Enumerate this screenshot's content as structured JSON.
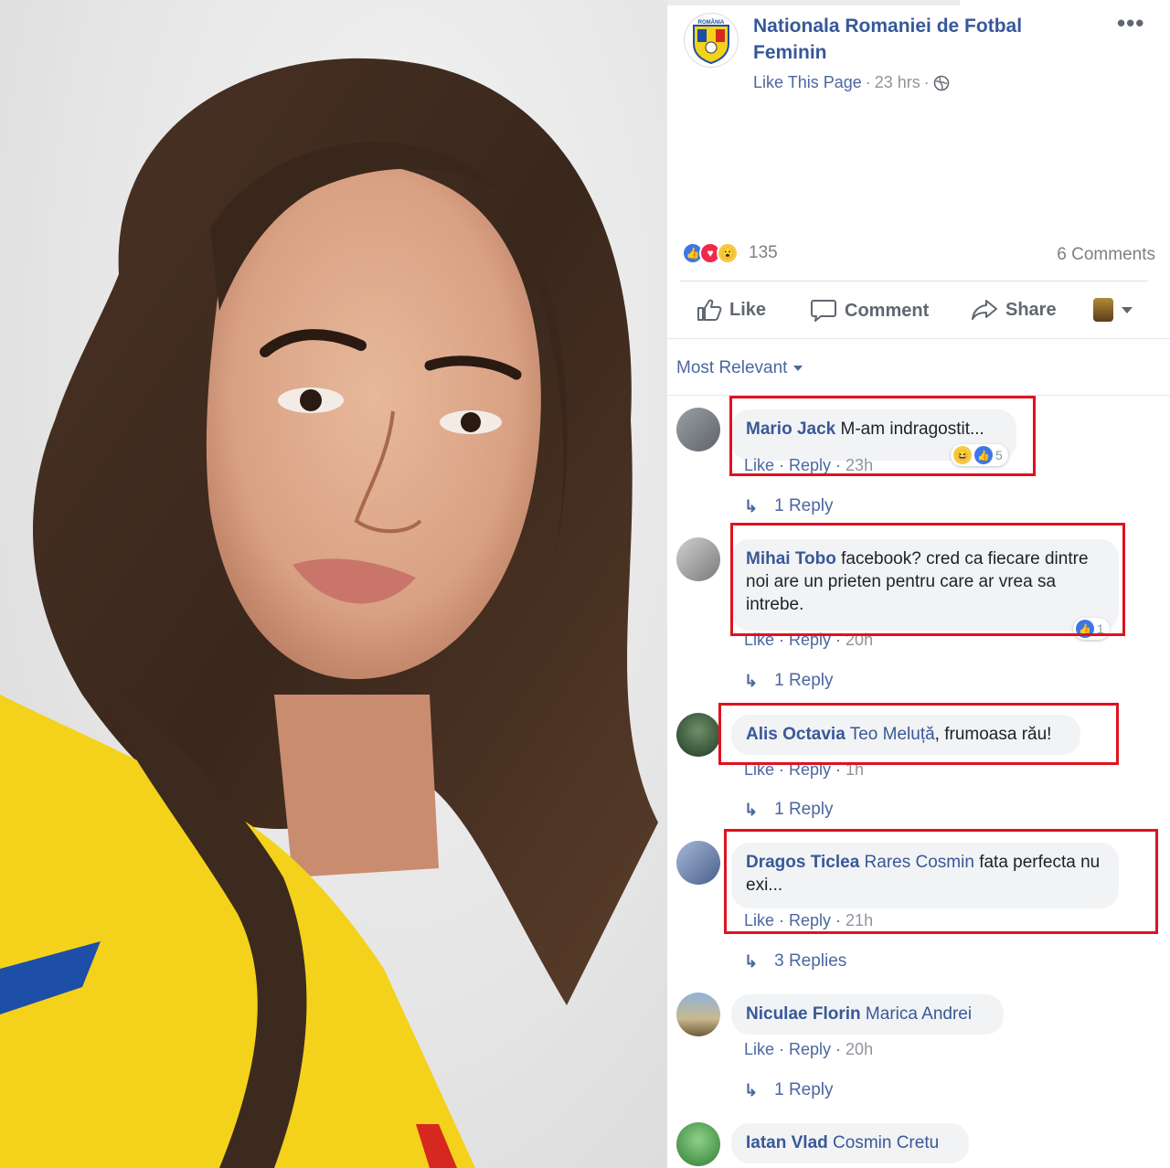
{
  "post": {
    "page_name": "Nationala Romaniei de Fotbal Feminin",
    "logo_text": "ROMÂNIA",
    "like_page": "Like This Page",
    "time": "23 hrs",
    "more": "•••",
    "reaction_count": "135",
    "comments_count": "6 Comments"
  },
  "actions": {
    "like": "Like",
    "comment": "Comment",
    "share": "Share"
  },
  "sort": {
    "label": "Most Relevant"
  },
  "comments": [
    {
      "author": "Mario Jack",
      "tag": "",
      "text": "M-am indragostit...",
      "meta": "Like · Reply · ",
      "time": "23h",
      "reactions": "5",
      "replies": "1 Reply",
      "highlighted": true
    },
    {
      "author": "Mihai Tobo",
      "tag": "",
      "text": "facebook? cred ca fiecare dintre noi are un prieten pentru care ar vrea sa intrebe.",
      "meta": "Like · Reply · ",
      "time": "20h",
      "reactions": "1",
      "replies": "1 Reply",
      "highlighted": true
    },
    {
      "author": "Alis Octavia",
      "tag": "Teo Meluță",
      "text": ", frumoasa rău!",
      "meta": "Like · Reply · ",
      "time": "1h",
      "reactions": "",
      "replies": "1 Reply",
      "highlighted": true
    },
    {
      "author": "Dragos Ticlea",
      "tag": "Rares Cosmin",
      "text": "fata perfecta nu exi...",
      "meta": "Like · Reply · ",
      "time": "21h",
      "reactions": "",
      "replies": "3 Replies",
      "highlighted": true
    },
    {
      "author": "Niculae Florin",
      "tag": "Marica Andrei",
      "text": "",
      "meta": "Like · Reply · ",
      "time": "20h",
      "reactions": "",
      "replies": "1 Reply",
      "highlighted": false
    },
    {
      "author": "Iatan Vlad",
      "tag": "Cosmin Cretu",
      "text": "",
      "meta": "",
      "time": "",
      "reactions": "",
      "replies": "",
      "highlighted": false
    }
  ],
  "colors": {
    "link": "#385898",
    "highlight": "#e0121f",
    "jersey": "#f4d21b"
  },
  "icons": [
    "globe-icon",
    "thumbs-up-icon",
    "comment-icon",
    "share-icon",
    "caret-down-icon",
    "reply-arrow-icon"
  ]
}
